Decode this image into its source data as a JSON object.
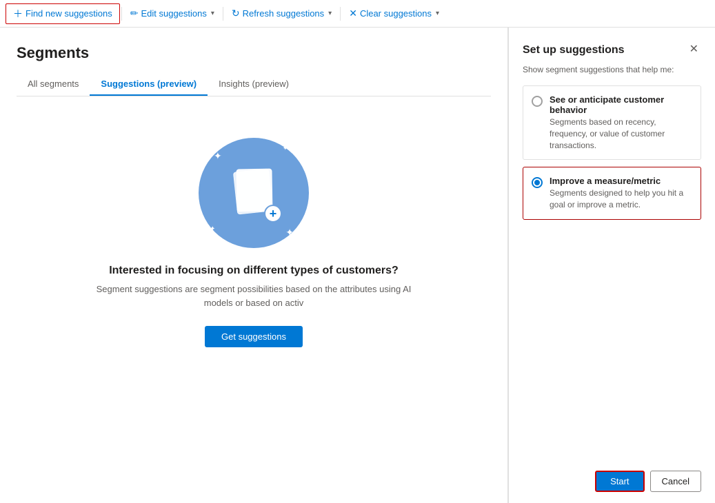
{
  "toolbar": {
    "find_new_label": "Find new suggestions",
    "edit_label": "Edit suggestions",
    "refresh_label": "Refresh suggestions",
    "clear_label": "Clear suggestions"
  },
  "page": {
    "title": "Segments",
    "tabs": [
      {
        "id": "all",
        "label": "All segments",
        "active": false
      },
      {
        "id": "suggestions",
        "label": "Suggestions (preview)",
        "active": true
      },
      {
        "id": "insights",
        "label": "Insights (preview)",
        "active": false
      }
    ]
  },
  "illustration": {
    "title": "Interested in focusing on different types of customers?",
    "description": "Segment suggestions are segment possibilities based on the attributes using AI models or based on activ",
    "get_suggestions_label": "Get suggestions"
  },
  "panel": {
    "title": "Set up suggestions",
    "description": "Show segment suggestions that help me:",
    "options": [
      {
        "id": "behavior",
        "label": "See or anticipate customer behavior",
        "sublabel": "Segments based on recency, frequency, or value of customer transactions.",
        "selected": false
      },
      {
        "id": "metric",
        "label": "Improve a measure/metric",
        "sublabel": "Segments designed to help you hit a goal or improve a metric.",
        "selected": true
      }
    ],
    "start_label": "Start",
    "cancel_label": "Cancel"
  }
}
